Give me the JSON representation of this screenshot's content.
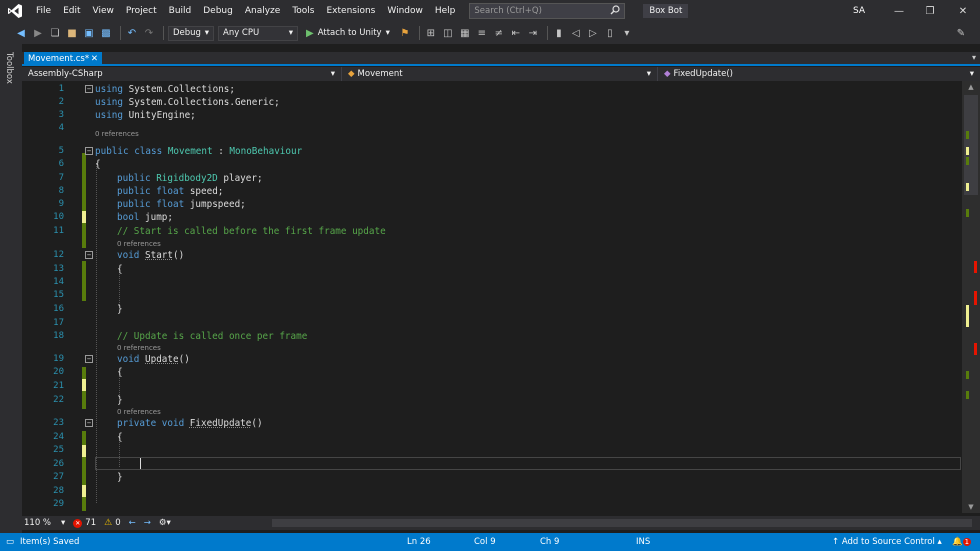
{
  "menu": {
    "items": [
      "File",
      "Edit",
      "View",
      "Project",
      "Build",
      "Debug",
      "Analyze",
      "Tools",
      "Extensions",
      "Window",
      "Help"
    ],
    "search_placeholder": "Search (Ctrl+Q)",
    "solution_name": "Box Bot",
    "user_initials": "SA"
  },
  "toolbar": {
    "configuration": "Debug",
    "platform": "Any CPU",
    "attach_label": "Attach to Unity"
  },
  "toolbox": {
    "label": "Toolbox"
  },
  "tabs": [
    {
      "label": "Movement.cs*",
      "active": true
    }
  ],
  "navbar": {
    "project": "Assembly-CSharp",
    "class": "Movement",
    "member": "FixedUpdate()"
  },
  "editor": {
    "refs_text": "0 references",
    "lines": [
      {
        "n": "1",
        "tokens": [
          [
            "kw",
            "using"
          ],
          [
            "",
            "System.Collections;"
          ]
        ]
      },
      {
        "n": "2",
        "tokens": [
          [
            "kw",
            "using"
          ],
          [
            "",
            "System.Collections.Generic;"
          ]
        ]
      },
      {
        "n": "3",
        "tokens": [
          [
            "kw",
            "using"
          ],
          [
            "",
            "UnityEngine;"
          ]
        ]
      },
      {
        "n": "4",
        "tokens": []
      },
      {
        "n": "5",
        "tokens": [
          [
            "kw",
            "public"
          ],
          [
            "kw",
            "class"
          ],
          [
            "ty",
            "Movement"
          ],
          [
            "",
            ":"
          ],
          [
            "ty",
            "MonoBehaviour"
          ]
        ]
      },
      {
        "n": "6",
        "tokens": [
          [
            "",
            "{"
          ]
        ]
      },
      {
        "n": "7",
        "tokens": [
          [
            "kw",
            "public"
          ],
          [
            "ty",
            "Rigidbody2D"
          ],
          [
            "",
            "player;"
          ]
        ]
      },
      {
        "n": "8",
        "tokens": [
          [
            "kw",
            "public"
          ],
          [
            "kw",
            "float"
          ],
          [
            "",
            "speed;"
          ]
        ]
      },
      {
        "n": "9",
        "tokens": [
          [
            "kw",
            "public"
          ],
          [
            "kw",
            "float"
          ],
          [
            "",
            "jumpspeed;"
          ]
        ]
      },
      {
        "n": "10",
        "tokens": [
          [
            "kw",
            "bool"
          ],
          [
            "",
            "jump;"
          ]
        ]
      },
      {
        "n": "11",
        "tokens": [
          [
            "cm",
            "// Start is called before the first frame update"
          ]
        ]
      },
      {
        "n": "12",
        "tokens": [
          [
            "kw",
            "void"
          ],
          [
            "fn",
            "Start"
          ],
          [
            "",
            "()"
          ]
        ]
      },
      {
        "n": "13",
        "tokens": [
          [
            "",
            "{"
          ]
        ]
      },
      {
        "n": "14",
        "tokens": []
      },
      {
        "n": "15",
        "tokens": []
      },
      {
        "n": "16",
        "tokens": [
          [
            "",
            "}"
          ]
        ]
      },
      {
        "n": "17",
        "tokens": []
      },
      {
        "n": "18",
        "tokens": [
          [
            "cm",
            "// Update is called once per frame"
          ]
        ]
      },
      {
        "n": "19",
        "tokens": [
          [
            "kw",
            "void"
          ],
          [
            "fn",
            "Update"
          ],
          [
            "",
            "()"
          ]
        ]
      },
      {
        "n": "20",
        "tokens": [
          [
            "",
            "{"
          ]
        ]
      },
      {
        "n": "21",
        "tokens": []
      },
      {
        "n": "22",
        "tokens": [
          [
            "",
            "}"
          ]
        ]
      },
      {
        "n": "23",
        "tokens": [
          [
            "kw",
            "private"
          ],
          [
            "kw",
            "void"
          ],
          [
            "fn",
            "FixedUpdate"
          ],
          [
            "",
            "()"
          ]
        ]
      },
      {
        "n": "24",
        "tokens": [
          [
            "",
            "{"
          ]
        ]
      },
      {
        "n": "25",
        "tokens": []
      },
      {
        "n": "26",
        "tokens": []
      },
      {
        "n": "27",
        "tokens": [
          [
            "",
            "}"
          ]
        ]
      },
      {
        "n": "28",
        "tokens": []
      },
      {
        "n": "29",
        "tokens": []
      }
    ]
  },
  "editor_status": {
    "zoom": "110 %",
    "errors": "71",
    "warnings": "0"
  },
  "statusbar": {
    "message": "Item(s) Saved",
    "ln": "Ln 26",
    "col": "Col 9",
    "ch": "Ch 9",
    "mode": "INS",
    "source_control": "Add to Source Control",
    "notifications": "1"
  },
  "colors": {
    "accent": "#007acc",
    "keyword": "#569cd6",
    "type": "#4ec9b0",
    "comment": "#57a64a",
    "line_number": "#2b91af"
  }
}
